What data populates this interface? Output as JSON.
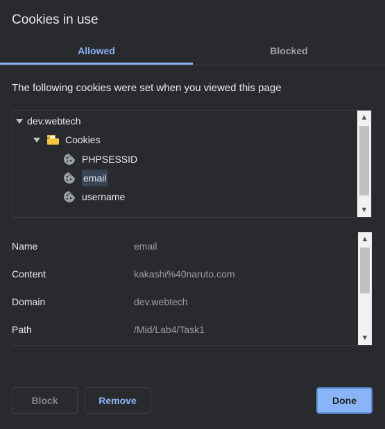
{
  "dialog": {
    "title": "Cookies in use"
  },
  "tabs": [
    {
      "label": "Allowed",
      "active": true
    },
    {
      "label": "Blocked",
      "active": false
    }
  ],
  "description": "The following cookies were set when you viewed this page",
  "tree": {
    "site": "dev.webtech",
    "folder": "Cookies",
    "cookies": [
      "PHPSESSID",
      "email",
      "username"
    ],
    "selected": "email"
  },
  "details": [
    {
      "label": "Name",
      "value": "email"
    },
    {
      "label": "Content",
      "value": "kakashi%40naruto.com"
    },
    {
      "label": "Domain",
      "value": "dev.webtech"
    },
    {
      "label": "Path",
      "value": "/Mid/Lab4/Task1"
    }
  ],
  "buttons": {
    "block": "Block",
    "remove": "Remove",
    "done": "Done"
  },
  "colors": {
    "accent": "#8ab4f8",
    "background": "#292a2d",
    "selection": "#394457"
  }
}
